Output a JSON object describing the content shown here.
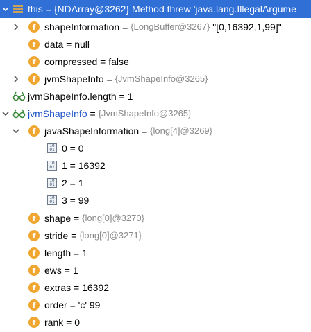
{
  "root": {
    "name": "this",
    "eq": " = ",
    "ref": "{NDArray@3262}",
    "value": "Method threw 'java.lang.IllegalArgume"
  },
  "rows": [
    {
      "name": "shapeInformation",
      "eq": " = ",
      "ref": "{LongBuffer@3267}",
      "value": "\"[0,16392,1,99]\""
    },
    {
      "name": "data",
      "eq": " = ",
      "ref": "",
      "value": "null"
    },
    {
      "name": "compressed",
      "eq": " = ",
      "ref": "",
      "value": "false"
    },
    {
      "name": "jvmShapeInfo",
      "eq": " = ",
      "ref": "{JvmShapeInfo@3265}",
      "value": ""
    },
    {
      "name": "jvmShapeInfo.length",
      "eq": " = ",
      "ref": "",
      "value": "1"
    },
    {
      "name": "jvmShapeInfo",
      "eq": " = ",
      "ref": "{JvmShapeInfo@3265}",
      "value": ""
    },
    {
      "name": "javaShapeInformation",
      "eq": " = ",
      "ref": "{long[4]@3269}",
      "value": ""
    },
    {
      "name": "0",
      "eq": " = ",
      "ref": "",
      "value": "0"
    },
    {
      "name": "1",
      "eq": " = ",
      "ref": "",
      "value": "16392"
    },
    {
      "name": "2",
      "eq": " = ",
      "ref": "",
      "value": "1"
    },
    {
      "name": "3",
      "eq": " = ",
      "ref": "",
      "value": "99"
    },
    {
      "name": "shape",
      "eq": " = ",
      "ref": "{long[0]@3270}",
      "value": ""
    },
    {
      "name": "stride",
      "eq": " = ",
      "ref": "{long[0]@3271}",
      "value": ""
    },
    {
      "name": "length",
      "eq": " = ",
      "ref": "",
      "value": "1"
    },
    {
      "name": "ews",
      "eq": " = ",
      "ref": "",
      "value": "1"
    },
    {
      "name": "extras",
      "eq": " = ",
      "ref": "",
      "value": "16392"
    },
    {
      "name": "order",
      "eq": " = ",
      "ref": "",
      "value": "'c' 99"
    },
    {
      "name": "rank",
      "eq": " = ",
      "ref": "",
      "value": "0"
    }
  ],
  "icons": {
    "field": "f",
    "array_element_top": "10",
    "array_element_bottom": "01"
  },
  "colors": {
    "selection": "#2f6fd6",
    "field_icon": "#f0a732",
    "reference_gray": "#8a8a8a",
    "watch_blue": "#1f54c7"
  }
}
